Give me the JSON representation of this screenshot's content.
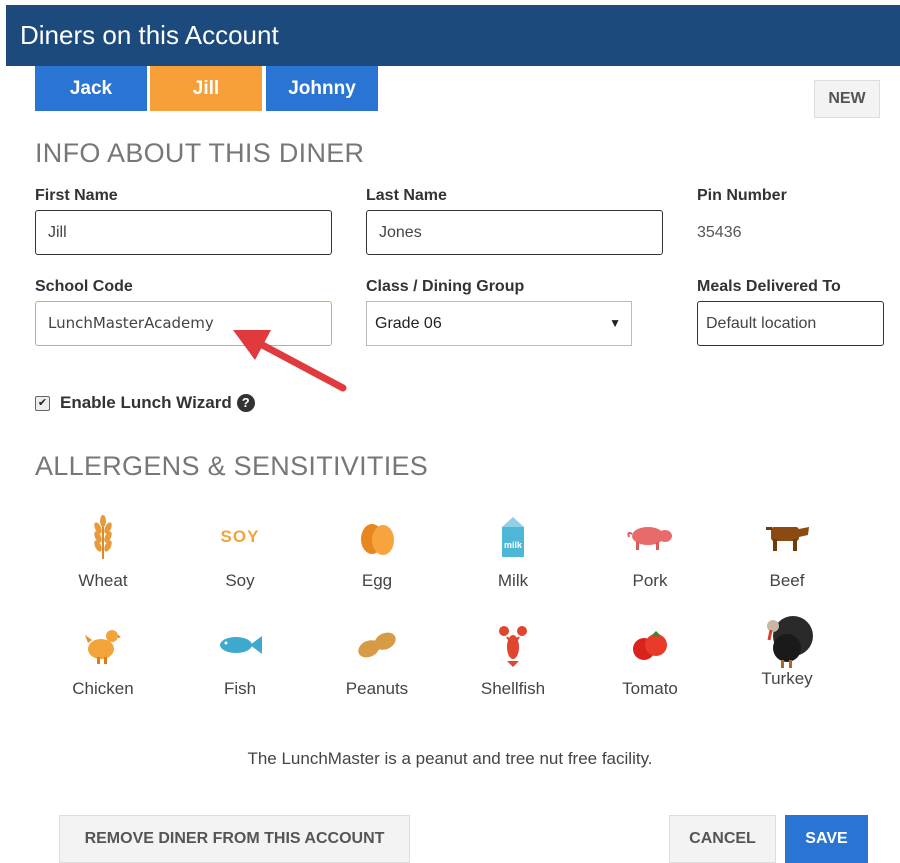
{
  "header": {
    "title": "Diners on this Account"
  },
  "diner_tabs": [
    {
      "label": "Jack",
      "color": "#2a74d4"
    },
    {
      "label": "Jill",
      "color": "#f7a03a"
    },
    {
      "label": "Johnny",
      "color": "#2a74d4"
    }
  ],
  "new_button": "NEW",
  "info_section": {
    "title": "INFO ABOUT THIS DINER",
    "first_name_label": "First Name",
    "first_name_value": "Jill",
    "last_name_label": "Last Name",
    "last_name_value": "Jones",
    "pin_label": "Pin Number",
    "pin_value": "35436",
    "school_code_label": "School Code",
    "school_code_value": "LunchMasterAcademy",
    "class_label": "Class / Dining Group",
    "class_value": "Grade 06",
    "meals_label": "Meals Delivered To",
    "meals_value": "Default location",
    "lunch_wizard_label": "Enable Lunch Wizard",
    "lunch_wizard_checked": true
  },
  "allergens": {
    "title": "ALLERGENS & SENSITIVITIES",
    "items": [
      {
        "name": "Wheat",
        "icon": "wheat-icon"
      },
      {
        "name": "Soy",
        "icon": "soy-icon"
      },
      {
        "name": "Egg",
        "icon": "egg-icon"
      },
      {
        "name": "Milk",
        "icon": "milk-icon"
      },
      {
        "name": "Pork",
        "icon": "pork-icon"
      },
      {
        "name": "Beef",
        "icon": "beef-icon"
      },
      {
        "name": "Chicken",
        "icon": "chicken-icon"
      },
      {
        "name": "Fish",
        "icon": "fish-icon"
      },
      {
        "name": "Peanuts",
        "icon": "peanuts-icon"
      },
      {
        "name": "Shellfish",
        "icon": "shellfish-icon"
      },
      {
        "name": "Tomato",
        "icon": "tomato-icon"
      },
      {
        "name": "Turkey",
        "icon": "turkey-icon"
      }
    ],
    "soy_icon_text": "SOY",
    "milk_icon_text": "milk"
  },
  "facility_note": "The LunchMaster is a peanut and tree nut free facility.",
  "buttons": {
    "remove": "REMOVE DINER FROM THIS ACCOUNT",
    "cancel": "CANCEL",
    "save": "SAVE"
  },
  "colors": {
    "header": "#1d4a7c",
    "accent_blue": "#2a74d4",
    "accent_orange": "#f7a03a",
    "arrow": "#e03a3e"
  }
}
